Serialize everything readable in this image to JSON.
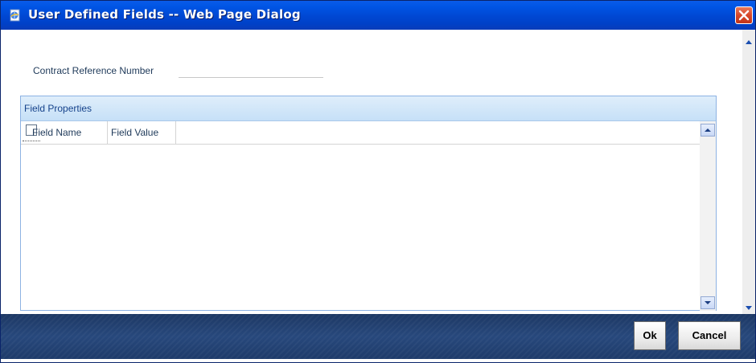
{
  "window": {
    "title": "User Defined Fields -- Web Page Dialog",
    "title_icon": "ie-page-icon",
    "close_icon": "close-icon",
    "colors": {
      "titlebar": "#0047d2",
      "close": "#d8482a",
      "footer": "#27487c",
      "section_header": "#c6e0f7"
    }
  },
  "form": {
    "contract_ref_label": "Contract Reference Number",
    "contract_ref_value": ""
  },
  "field_properties": {
    "title": "Field Properties",
    "columns": [
      "Field Name",
      "Field Value"
    ],
    "rows": []
  },
  "footer": {
    "ok_label": "Ok",
    "cancel_label": "Cancel"
  }
}
